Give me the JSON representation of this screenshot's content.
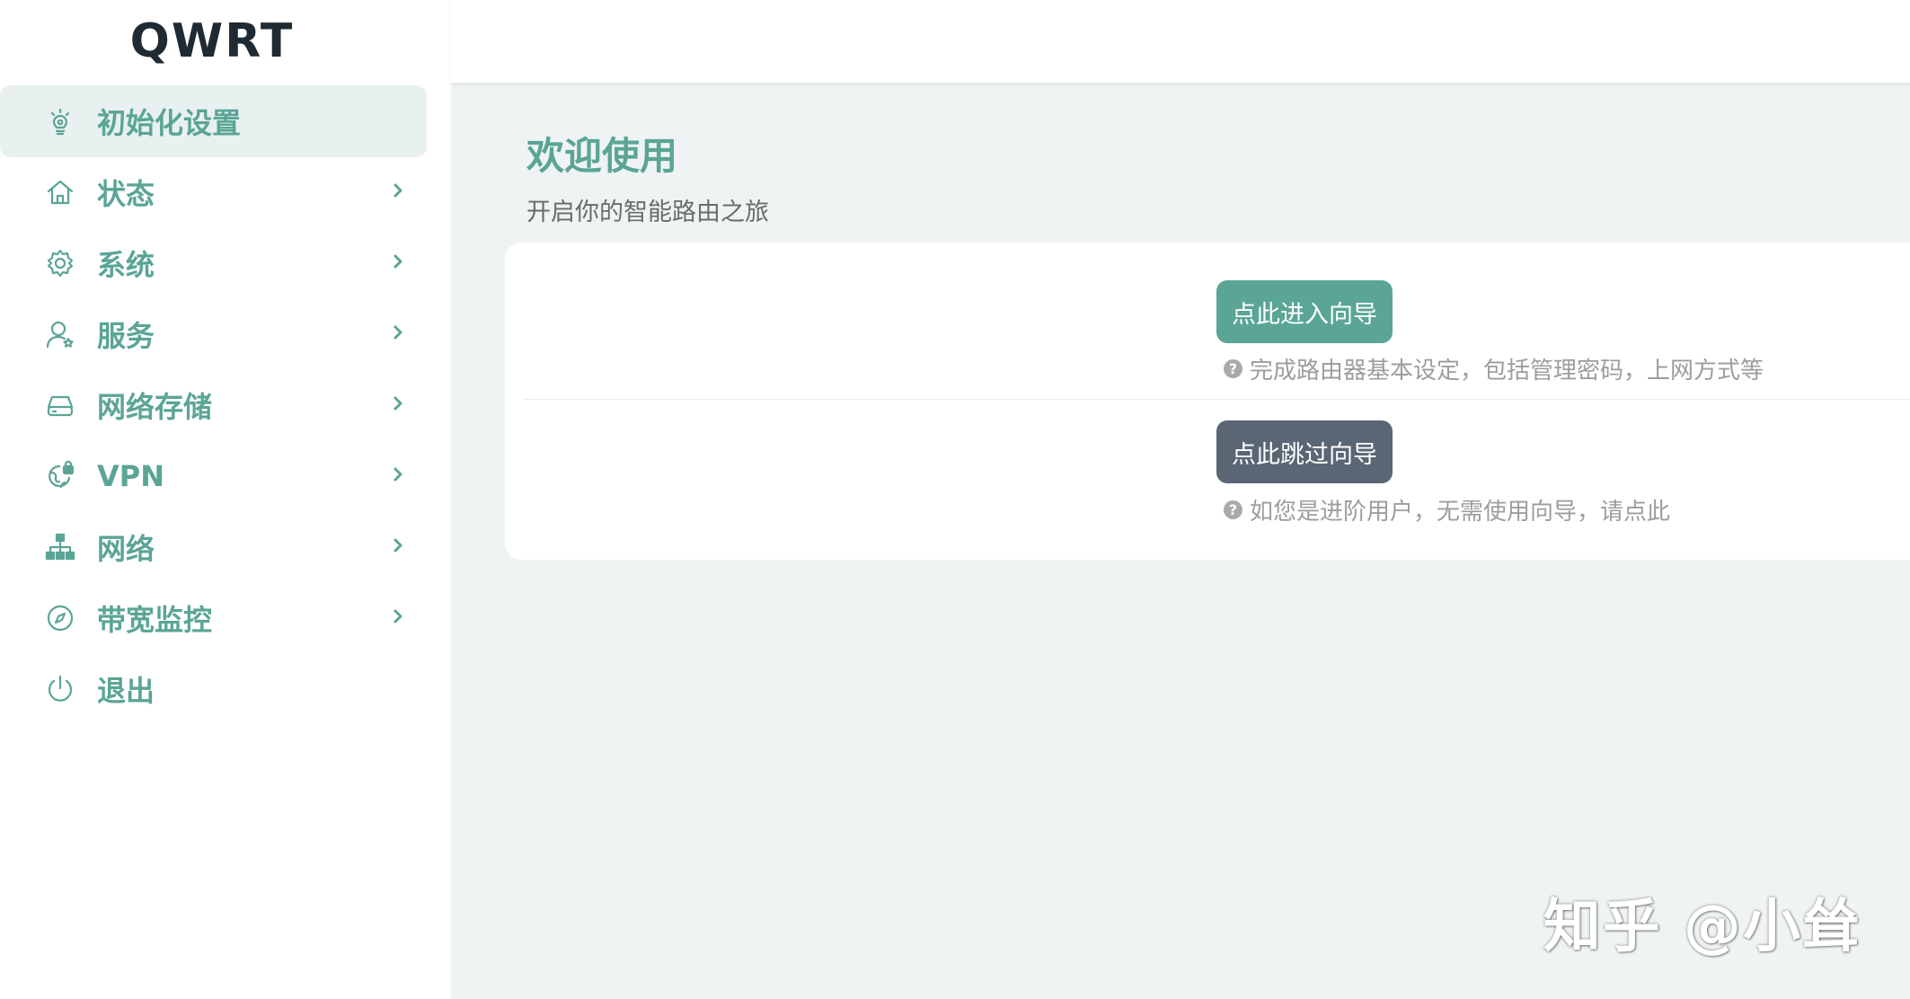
{
  "brand": {
    "title": "QWRT"
  },
  "sidebar": {
    "items": [
      {
        "label": "初始化设置",
        "icon": "lightbulb-gear-icon",
        "active": true,
        "has_chevron": false
      },
      {
        "label": "状态",
        "icon": "home-icon",
        "active": false,
        "has_chevron": true
      },
      {
        "label": "系统",
        "icon": "gear-icon",
        "active": false,
        "has_chevron": true
      },
      {
        "label": "服务",
        "icon": "user-star-icon",
        "active": false,
        "has_chevron": true
      },
      {
        "label": "网络存储",
        "icon": "hard-drive-icon",
        "active": false,
        "has_chevron": true
      },
      {
        "label": "VPN",
        "icon": "globe-lock-icon",
        "active": false,
        "has_chevron": true
      },
      {
        "label": "网络",
        "icon": "network-tree-icon",
        "active": false,
        "has_chevron": true
      },
      {
        "label": "带宽监控",
        "icon": "compass-icon",
        "active": false,
        "has_chevron": true
      },
      {
        "label": "退出",
        "icon": "power-icon",
        "active": false,
        "has_chevron": false
      }
    ]
  },
  "main": {
    "title": "欢迎使用",
    "subtitle": "开启你的智能路由之旅",
    "enter_wizard": {
      "button_label": "点此进入向导",
      "hint": "完成路由器基本设定，包括管理密码，上网方式等"
    },
    "skip_wizard": {
      "button_label": "点此跳过向导",
      "hint": "如您是进阶用户，无需使用向导，请点此"
    }
  },
  "watermark": {
    "text": "知乎 @小耸"
  },
  "colors": {
    "accent": "#5aa596",
    "skip_button": "#5b6675",
    "main_bg": "#eff3f3",
    "active_item_bg": "#e9f1f0"
  }
}
